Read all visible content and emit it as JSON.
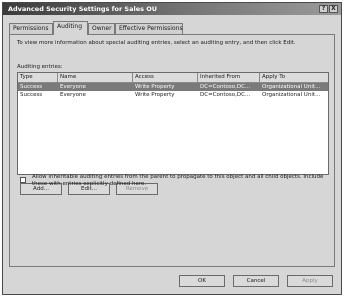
{
  "window": {
    "title": "Advanced Security Settings for Sales OU",
    "controls": [
      "?",
      "X"
    ]
  },
  "tabs": [
    {
      "label": "Permissions",
      "active": false
    },
    {
      "label": "Auditing",
      "active": true
    },
    {
      "label": "Owner",
      "active": false
    },
    {
      "label": "Effective Permissions",
      "active": false
    }
  ],
  "auditing": {
    "instructions": "To view more information about special auditing entries, select an auditing entry, and then click Edit.",
    "entries_label": "Auditing entries:",
    "columns": [
      "Type",
      "Name",
      "Access",
      "Inherited From",
      "Apply To"
    ],
    "rows": [
      {
        "type": "Success",
        "name": "Everyone",
        "access": "Write Property",
        "inherited_from": "DC=Contoso,DC...",
        "apply_to": "Organizational Unit...",
        "selected": true
      },
      {
        "type": "Success",
        "name": "Everyone",
        "access": "Write Property",
        "inherited_from": "DC=Contoso,DC...",
        "apply_to": "Organizational Unit...",
        "selected": false
      }
    ],
    "buttons": {
      "add": "Add...",
      "edit": "Edit...",
      "remove": "Remove"
    },
    "inherit_checkbox": {
      "checked": false,
      "label": "Allow inheritable auditing entries from the parent to propagate to this object and all child objects. Include these with entries explicitly defined here."
    }
  },
  "footer": {
    "ok": "OK",
    "cancel": "Cancel",
    "apply": "Apply"
  },
  "colors": {
    "titlebar": "#3c3c3c",
    "selection": "#7a7a7a",
    "dialog_bg": "#d6d6d6"
  }
}
